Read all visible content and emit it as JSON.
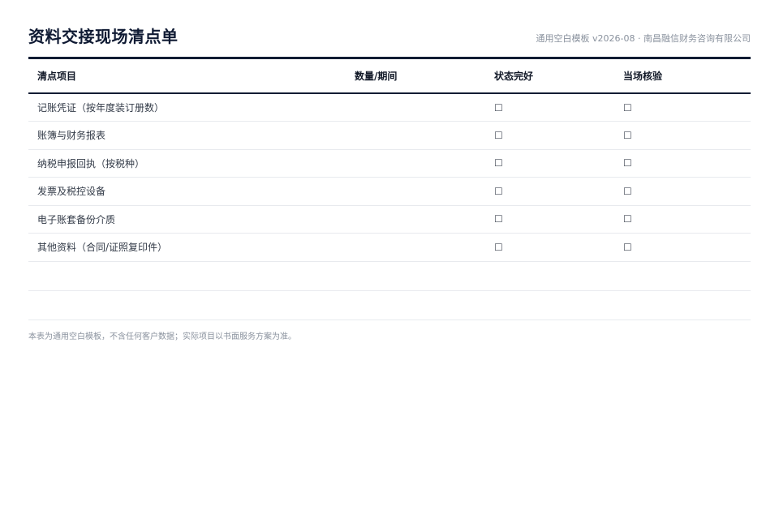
{
  "header": {
    "title": "资料交接现场清点单",
    "meta": "通用空白模板 v2026-08 · 南昌融信财务咨询有限公司"
  },
  "table": {
    "columns": [
      "清点项目",
      "数量/期间",
      "状态完好",
      "当场核验"
    ],
    "checkbox_glyph": "☐",
    "rows": [
      {
        "item": "记账凭证（按年度装订册数）",
        "qty": ""
      },
      {
        "item": "账簿与财务报表",
        "qty": ""
      },
      {
        "item": "纳税申报回执（按税种）",
        "qty": ""
      },
      {
        "item": "发票及税控设备",
        "qty": ""
      },
      {
        "item": "电子账套备份介质",
        "qty": ""
      },
      {
        "item": "其他资料（合同/证照复印件）",
        "qty": ""
      }
    ]
  },
  "footer": {
    "note": "本表为通用空白模板，不含任何客户数据；实际项目以书面服务方案为准。"
  }
}
